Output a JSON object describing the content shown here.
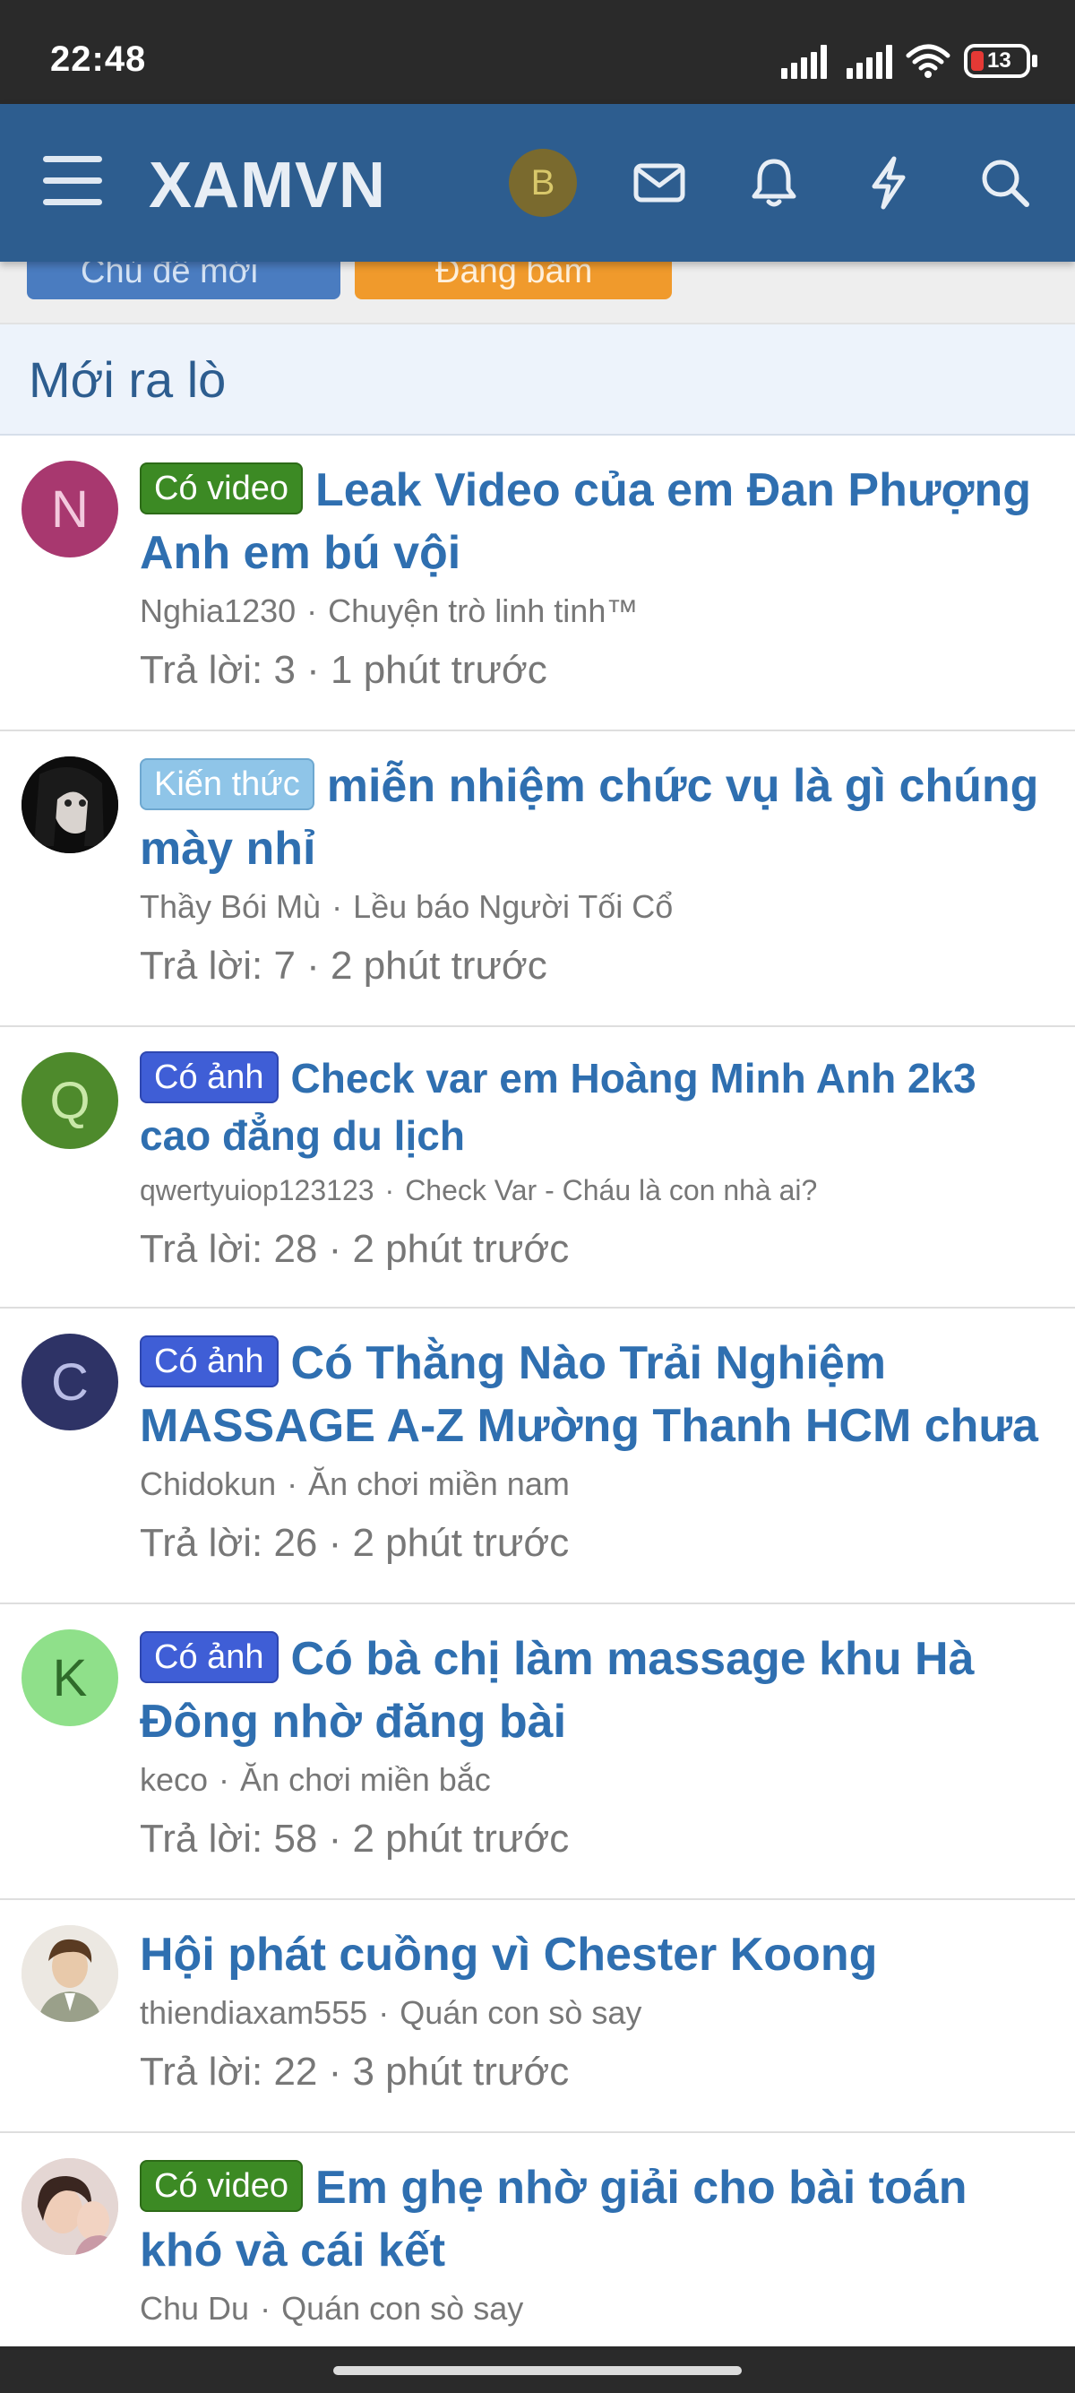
{
  "status_bar": {
    "time": "22:48",
    "battery": "13"
  },
  "header": {
    "logo": "XAMVN",
    "user_initial": "B"
  },
  "actions": {
    "new_thread": "Chủ đề mới",
    "watch": "Đang bám"
  },
  "section": {
    "title": "Mới ra lò"
  },
  "threads": [
    {
      "avatar": "N",
      "tag": "Có video",
      "title": "Leak Video của em Đan Phượng Anh em bú vội",
      "author": "Nghia1230",
      "forum": "Chuyện trò linh tinh™",
      "stats": "Trả lời: 3 · 1 phút trước"
    },
    {
      "avatar": "",
      "tag": "Kiến thức",
      "title": "miễn nhiệm chức vụ là gì chúng mày nhỉ",
      "author": "Thầy Bói Mù",
      "forum": "Lều báo Người Tối Cổ",
      "stats": "Trả lời: 7 · 2 phút trước"
    },
    {
      "avatar": "Q",
      "tag": "Có ảnh",
      "title": "Check var em Hoàng Minh Anh 2k3 cao đẳng du lịch",
      "author": "qwertyuiop123123",
      "forum": "Check Var - Cháu là con nhà ai?",
      "stats": "Trả lời: 28 · 2 phút trước"
    },
    {
      "avatar": "C",
      "tag": "Có ảnh",
      "title": "Có Thằng Nào Trải Nghiệm MASSAGE A-Z Mường Thanh HCM chưa",
      "author": "Chidokun",
      "forum": "Ăn chơi miền nam",
      "stats": "Trả lời: 26 · 2 phút trước"
    },
    {
      "avatar": "K",
      "tag": "Có ảnh",
      "title": "Có bà chị làm massage khu Hà Đông nhờ đăng bài",
      "author": "keco",
      "forum": "Ăn chơi miền bắc",
      "stats": "Trả lời: 58 · 2 phút trước"
    },
    {
      "avatar": "",
      "tag": "",
      "title": "Hội phát cuồng vì Chester Koong",
      "author": "thiendiaxam555",
      "forum": "Quán con sò say",
      "stats": "Trả lời: 22 · 3 phút trước"
    },
    {
      "avatar": "",
      "tag": "Có video",
      "title": "Em ghẹ nhờ giải cho bài toán khó và cái kết",
      "author": "Chu Du",
      "forum": "Quán con sò say",
      "stats": ""
    }
  ],
  "colors": {
    "header_bg": "#2d5d8f",
    "link": "#2f6fb0",
    "tag_video": "#3c8a24",
    "tag_photo": "#3f5ed6",
    "tag_knowledge": "#8fc5e8"
  }
}
